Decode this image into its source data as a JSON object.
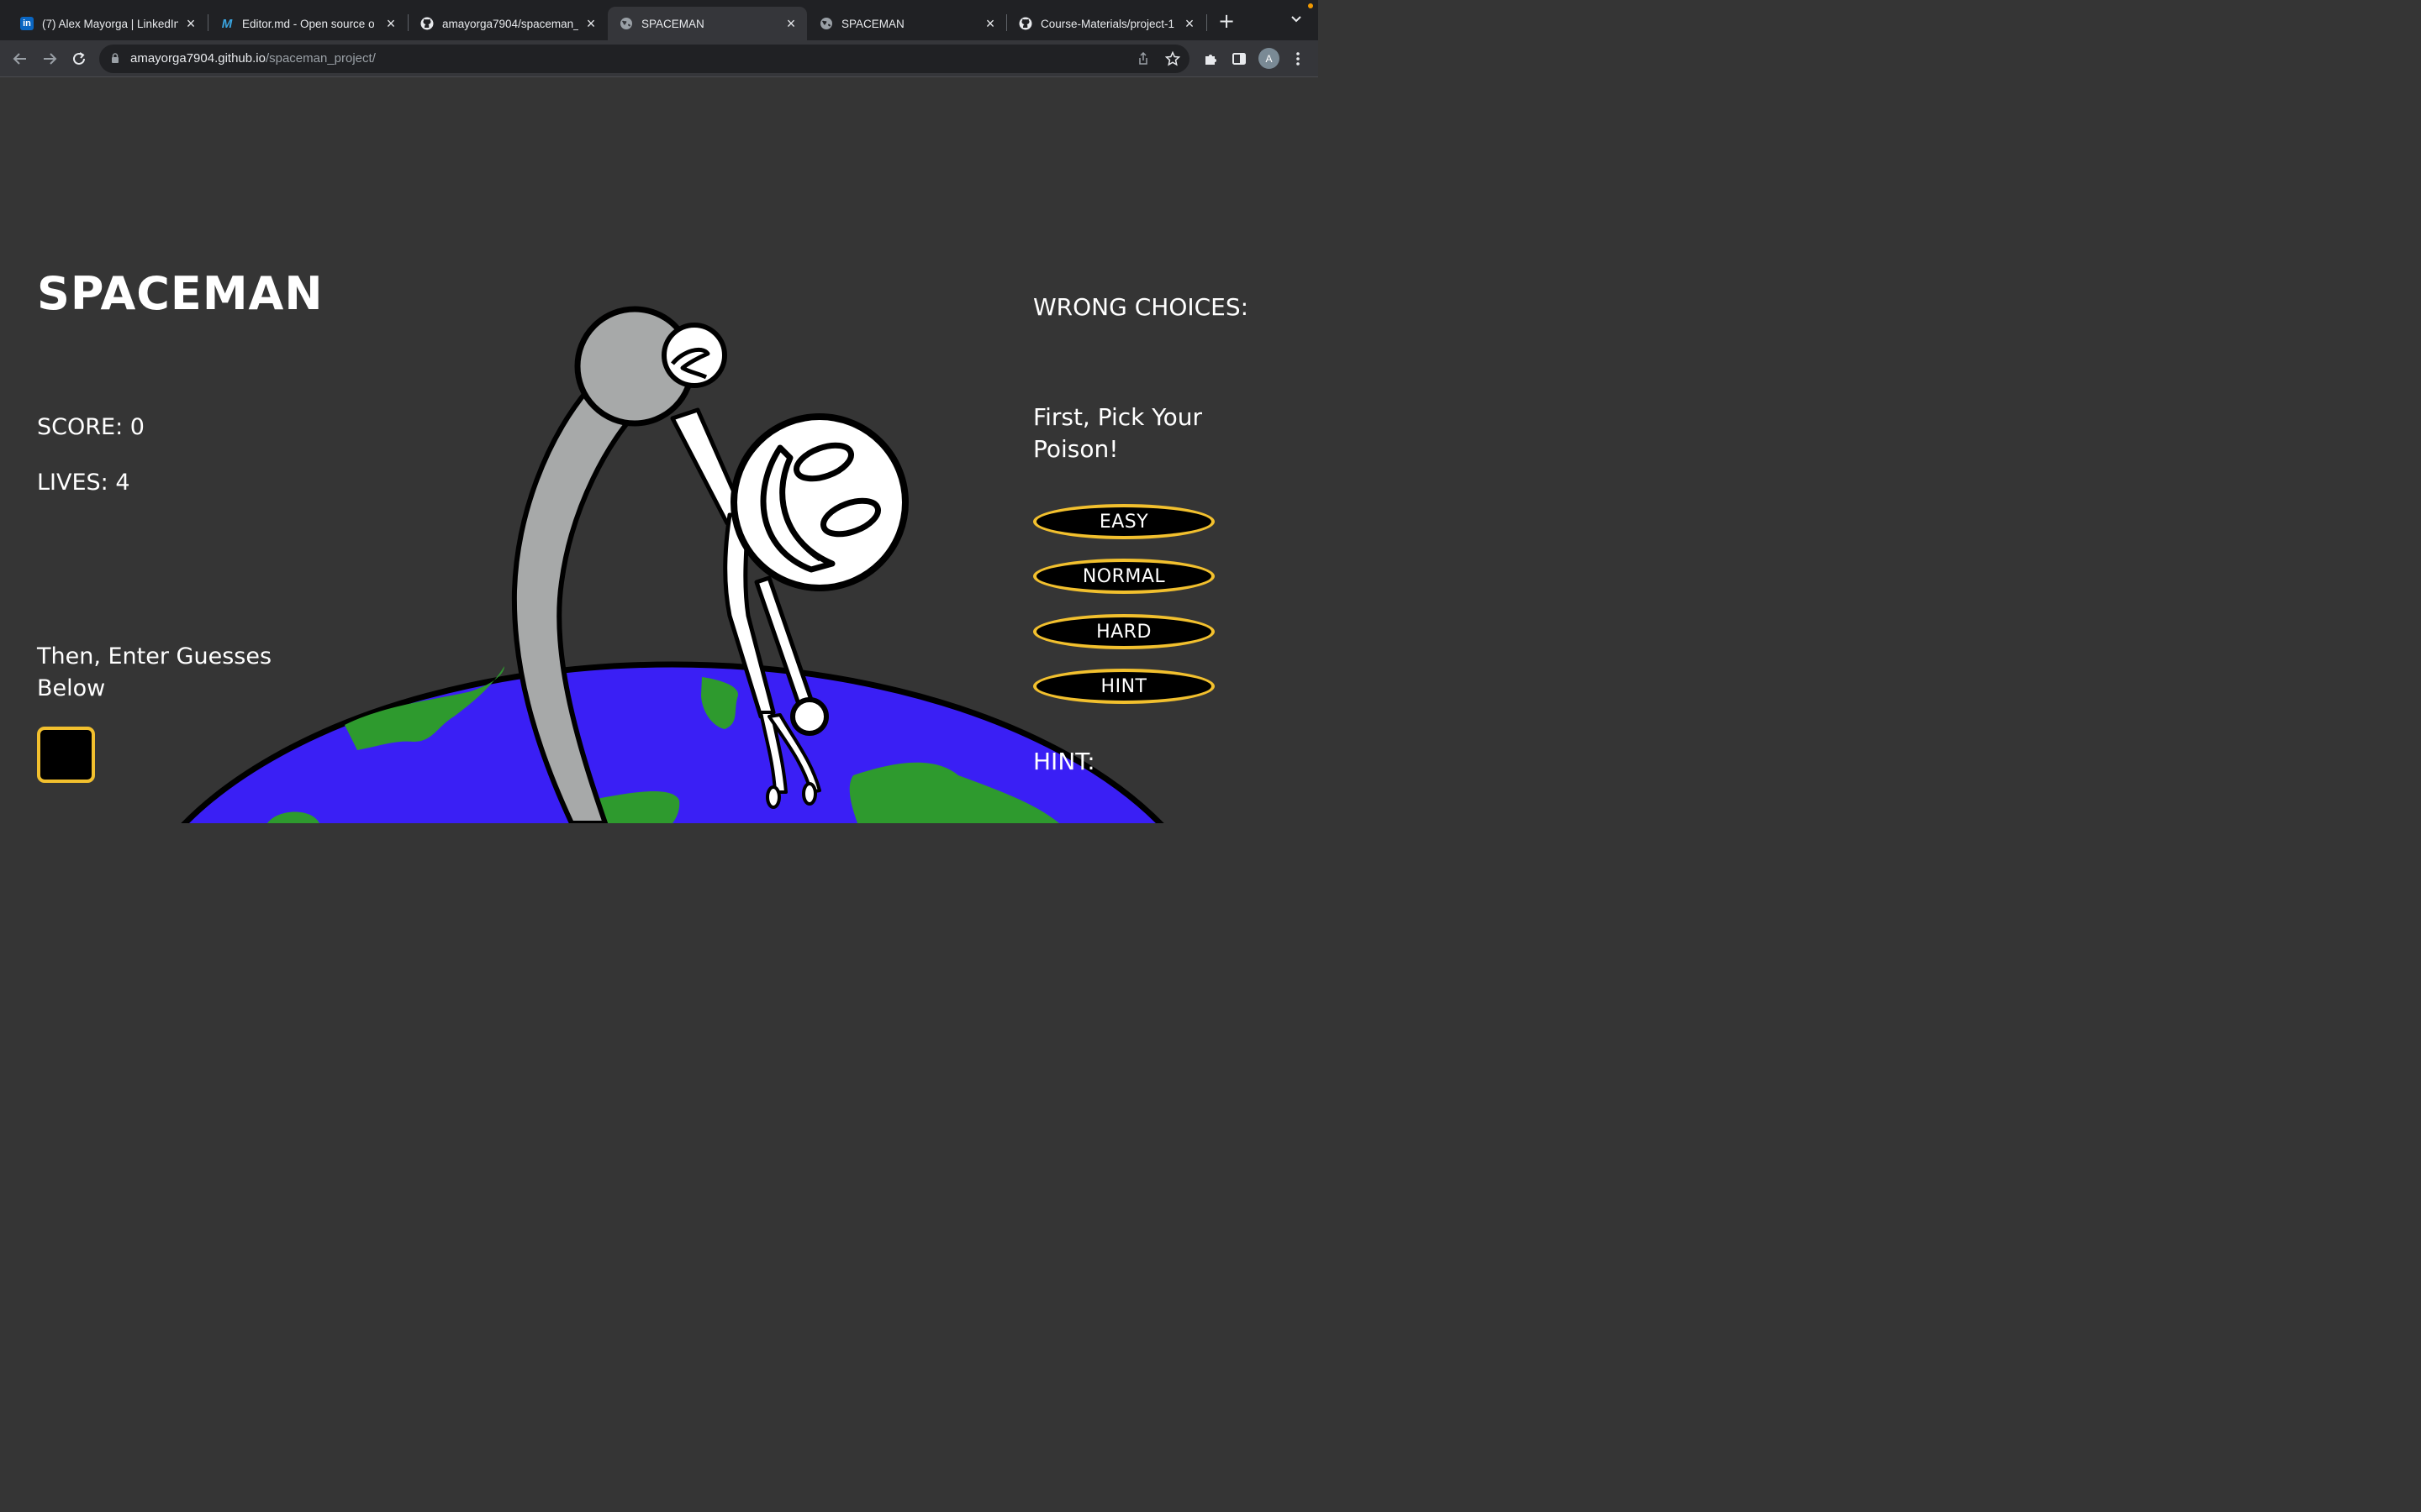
{
  "browser": {
    "tabs": [
      {
        "title": "(7) Alex Mayorga | LinkedIn",
        "icon": "linkedin-icon",
        "active": false
      },
      {
        "title": "Editor.md - Open source o",
        "icon": "editormd-icon",
        "active": false
      },
      {
        "title": "amayorga7904/spaceman_",
        "icon": "github-icon",
        "active": false
      },
      {
        "title": "SPACEMAN",
        "icon": "globe-icon",
        "active": true
      },
      {
        "title": "SPACEMAN",
        "icon": "globe-icon",
        "active": false
      },
      {
        "title": "Course-Materials/project-1",
        "icon": "github-icon",
        "active": false
      }
    ],
    "url_host": "amayorga7904.github.io",
    "url_path": "/spaceman_project/",
    "avatar_initial": "A"
  },
  "game": {
    "title": "SPACEMAN",
    "score_text": "SCORE: 0",
    "lives_text": "LIVES: 4",
    "instructions": "Then, Enter Guesses Below",
    "wrong_choices_label": "WRONG CHOICES:",
    "pick_label": "First, Pick Your Poison!",
    "buttons": {
      "easy": "EASY",
      "normal": "NORMAL",
      "hard": "HARD",
      "hint": "HINT"
    },
    "hint_label": "HINT:"
  },
  "colors": {
    "page_bg": "#353535",
    "accent": "#f2c02e",
    "ocean": "#3a1ff5",
    "land": "#2e9a2e",
    "moon": "#a7a9a9"
  }
}
